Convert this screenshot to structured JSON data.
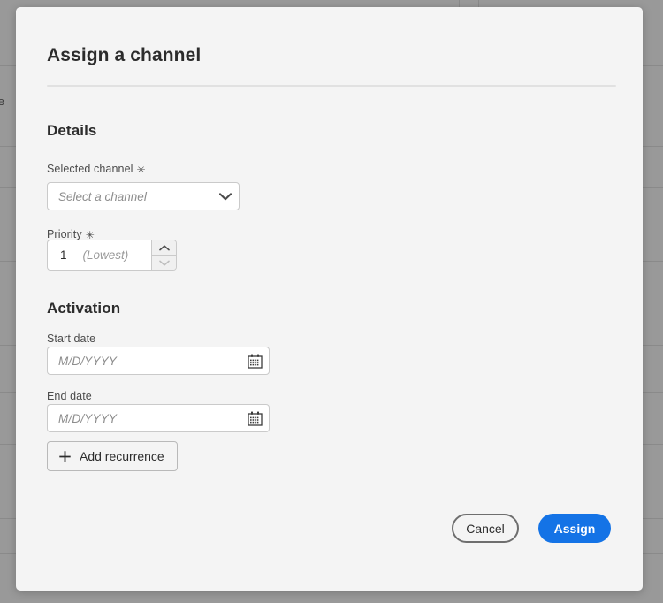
{
  "background": {
    "partial_text": "fe",
    "overlay_color": "#999999"
  },
  "dialog": {
    "title": "Assign a channel",
    "sections": {
      "details": {
        "heading": "Details",
        "fields": {
          "selected_channel": {
            "label": "Selected channel",
            "required_marker": "✳",
            "placeholder": "Select a channel",
            "value": "",
            "icon": "chevron-down-icon"
          },
          "priority": {
            "label": "Priority",
            "required_marker": "✳",
            "value": "1",
            "hint": "(Lowest)",
            "increment_icon": "chevron-up-icon",
            "decrement_icon": "chevron-down-icon"
          }
        }
      },
      "activation": {
        "heading": "Activation",
        "fields": {
          "start_date": {
            "label": "Start date",
            "placeholder": "M/D/YYYY",
            "value": "",
            "icon": "calendar-icon"
          },
          "end_date": {
            "label": "End date",
            "placeholder": "M/D/YYYY",
            "value": "",
            "icon": "calendar-icon"
          }
        },
        "add_recurrence": {
          "label": "Add recurrence",
          "icon": "plus-icon"
        }
      }
    },
    "footer": {
      "cancel_label": "Cancel",
      "assign_label": "Assign",
      "accent_color": "#1473E6"
    }
  },
  "colors": {
    "dialog_background": "#F4F4F4",
    "field_background": "#FFFFFF",
    "border": "#CACACA",
    "text_primary": "#2C2C2C",
    "text_secondary": "#4B4B4B",
    "placeholder": "#8D8D8D",
    "accent_blue": "#1473E6",
    "scrim": "#999999"
  }
}
